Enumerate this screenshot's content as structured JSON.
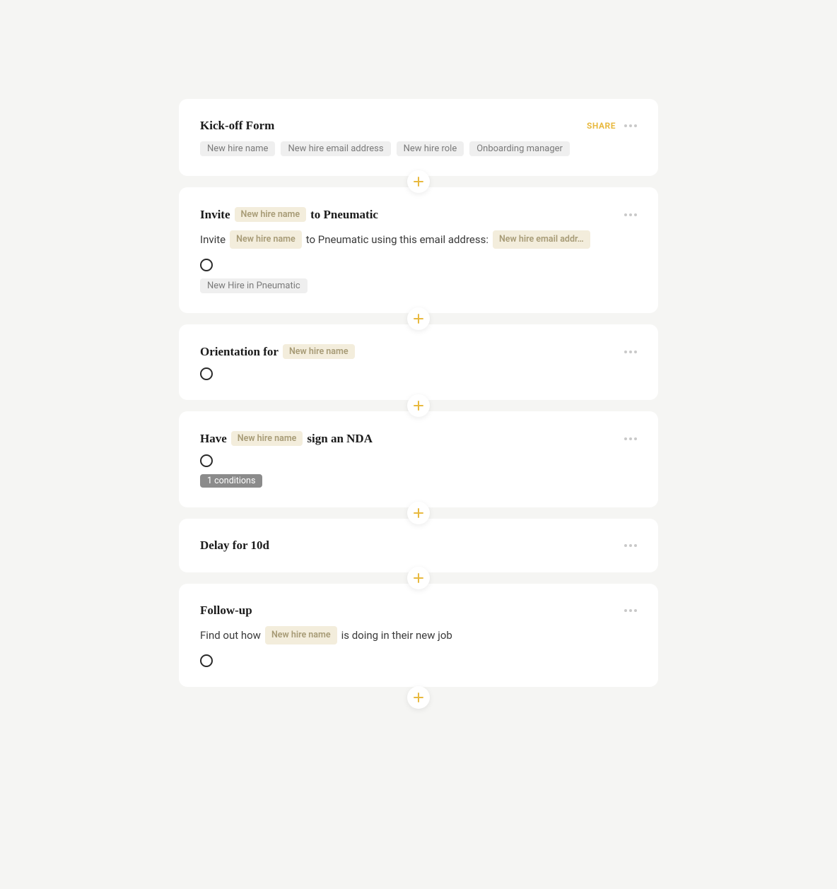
{
  "share_label": "SHARE",
  "var_new_hire_name": "New hire name",
  "var_new_hire_email": "New hire email addr…",
  "kickoff": {
    "title": "Kick-off Form",
    "chips": [
      "New hire name",
      "New hire email address",
      "New hire role",
      "Onboarding manager"
    ]
  },
  "invite": {
    "title_pre": "Invite",
    "title_post": "to Pneumatic",
    "body_pre": "Invite",
    "body_mid": "to Pneumatic using this email address:",
    "footer_chip": "New Hire in Pneumatic"
  },
  "orientation": {
    "title_pre": "Orientation for"
  },
  "nda": {
    "title_pre": "Have",
    "title_post": "sign an NDA",
    "conditions": "1 conditions"
  },
  "delay": {
    "title": "Delay for 10d"
  },
  "followup": {
    "title": "Follow-up",
    "body_pre": "Find out how",
    "body_post": "is doing in their new job"
  }
}
